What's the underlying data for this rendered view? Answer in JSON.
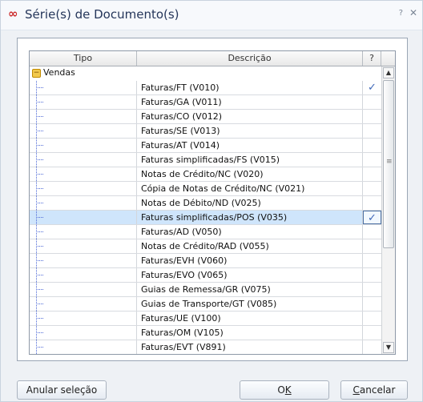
{
  "window": {
    "title": "Série(s) de Documento(s)",
    "help_glyph": "?",
    "close_glyph": "✕",
    "icon_glyph": "∞"
  },
  "grid": {
    "headers": [
      "Tipo",
      "Descrição",
      "?"
    ],
    "group": "Vendas",
    "rows": [
      {
        "desc": "Faturas/FT (V010)",
        "check": "✓"
      },
      {
        "desc": "Faturas/GA (V011)",
        "check": ""
      },
      {
        "desc": "Faturas/CO (V012)",
        "check": ""
      },
      {
        "desc": "Faturas/SE (V013)",
        "check": ""
      },
      {
        "desc": "Faturas/AT (V014)",
        "check": ""
      },
      {
        "desc": "Faturas simplificadas/FS (V015)",
        "check": ""
      },
      {
        "desc": "Notas de Crédito/NC (V020)",
        "check": ""
      },
      {
        "desc": "Cópia de Notas de Crédito/NC (V021)",
        "check": ""
      },
      {
        "desc": "Notas de Débito/ND (V025)",
        "check": ""
      },
      {
        "desc": "Faturas simplificadas/POS (V035)",
        "check": "✓",
        "selected": true
      },
      {
        "desc": "Faturas/AD (V050)",
        "check": ""
      },
      {
        "desc": "Notas de Crédito/RAD (V055)",
        "check": ""
      },
      {
        "desc": "Faturas/EVH (V060)",
        "check": ""
      },
      {
        "desc": "Faturas/EVO (V065)",
        "check": ""
      },
      {
        "desc": "Guias de Remessa/GR (V075)",
        "check": ""
      },
      {
        "desc": "Guias de Transporte/GT (V085)",
        "check": ""
      },
      {
        "desc": "Faturas/UE (V100)",
        "check": ""
      },
      {
        "desc": "Faturas/OM (V105)",
        "check": ""
      },
      {
        "desc": "Faturas/EVT (V891)",
        "check": ""
      }
    ]
  },
  "buttons": {
    "clear": "Anular seleção",
    "ok_pre": "O",
    "ok_ul": "K",
    "cancel_ul": "C",
    "cancel_post": "ancelar"
  }
}
